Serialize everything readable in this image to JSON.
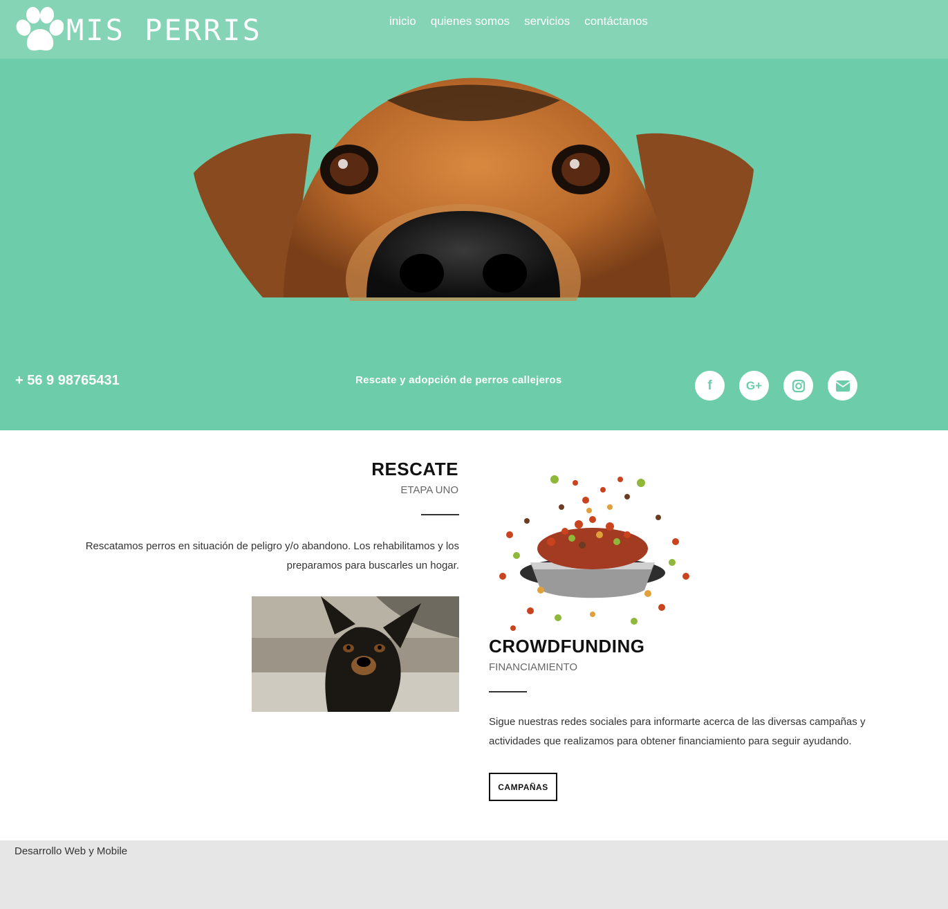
{
  "header": {
    "logo_text": "MIS PERRIS",
    "nav": [
      {
        "label": "inicio"
      },
      {
        "label": "quienes somos"
      },
      {
        "label": "servicios"
      },
      {
        "label": "contáctanos"
      }
    ]
  },
  "hero": {
    "phone": "+ 56 9 98765431",
    "tagline": "Rescate y adopción de perros callejeros",
    "socials": [
      {
        "icon": "facebook-icon",
        "glyph": "f"
      },
      {
        "icon": "google-plus-icon",
        "glyph": "G+"
      },
      {
        "icon": "instagram-icon",
        "glyph": ""
      },
      {
        "icon": "envelope-icon",
        "glyph": ""
      }
    ]
  },
  "rescate": {
    "title": "RESCATE",
    "subtitle": "ETAPA UNO",
    "text": "Rescatamos perros en situación de peligro y/o abandono. Los rehabilitamos y los preparamos para buscarles un hogar."
  },
  "crowdfunding": {
    "title": "CROWDFUNDING",
    "subtitle": "FINANCIAMIENTO",
    "text": "Sigue nuestras redes sociales para informarte acerca de las diversas campañas y actividades que realizamos para obtener financiamiento para seguir ayudando.",
    "button_label": "CAMPAÑAS"
  },
  "footer": {
    "text": "Desarrollo Web y Mobile"
  },
  "colors": {
    "header_bg": "#85d4b5",
    "hero_bg": "#6dcdaa",
    "footer_bg": "#e6e6e6"
  }
}
